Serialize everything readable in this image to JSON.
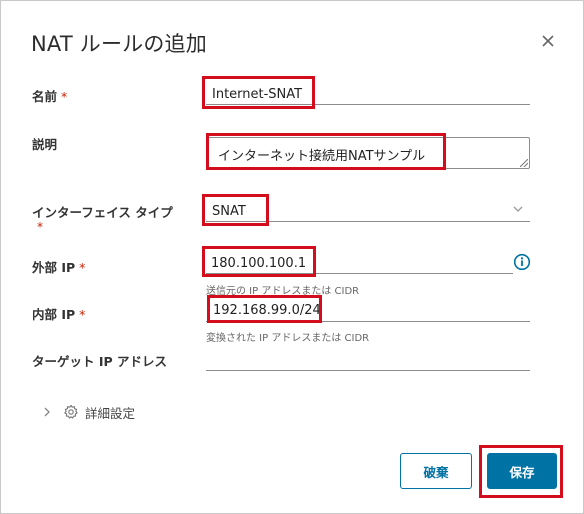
{
  "dialog": {
    "title": "NAT ルールの追加",
    "close_icon": "close-icon"
  },
  "form": {
    "name": {
      "label": "名前",
      "required_mark": "*",
      "value": "Internet-SNAT"
    },
    "description": {
      "label": "説明",
      "value": "インターネット接続用NATサンプル"
    },
    "interface_type": {
      "label": "インターフェイス タイプ",
      "required_mark": "*",
      "value": "SNAT"
    },
    "external_ip": {
      "label": "外部 IP",
      "required_mark": "*",
      "value": "180.100.100.1",
      "hint": "送信元の IP アドレスまたは CIDR",
      "info_icon": "info-icon"
    },
    "internal_ip": {
      "label": "内部 IP",
      "required_mark": "*",
      "value": "192.168.99.0/24",
      "hint": "変換された IP アドレスまたは CIDR"
    },
    "target_ip": {
      "label": "ターゲット IP アドレス",
      "value": ""
    },
    "advanced": {
      "label": "詳細設定",
      "icons": [
        "chevron-right-icon",
        "gear-icon"
      ]
    }
  },
  "buttons": {
    "cancel": "破棄",
    "save": "保存"
  },
  "colors": {
    "primary": "#0072a3",
    "required": "#c92100",
    "highlight": "#d40d1d"
  }
}
